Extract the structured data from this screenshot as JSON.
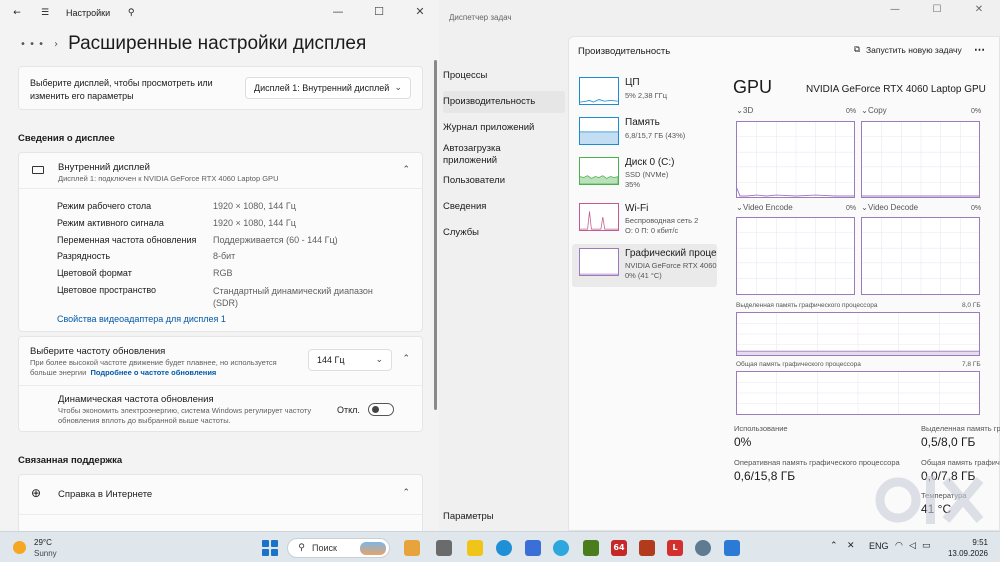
{
  "settings": {
    "title": "Настройки",
    "page_title": "Расширенные настройки дисплея",
    "select_display_text": "Выберите дисплей, чтобы просмотреть или изменить его параметры",
    "select_display_text_l1": "Выберите дисплей, чтобы просмотреть или",
    "select_display_text_l2": "изменить его параметры",
    "selected_display": "Дисплей 1: Внутренний дисплей",
    "display_info_heading": "Сведения о дисплее",
    "display_name": "Внутренний дисплей",
    "display_connection": "Дисплей 1: подключен к NVIDIA GeForce RTX 4060 Laptop GPU",
    "properties": [
      {
        "label": "Режим рабочего стола",
        "value": "1920 × 1080, 144 Гц"
      },
      {
        "label": "Режим активного сигнала",
        "value": "1920 × 1080, 144 Гц"
      },
      {
        "label": "Переменная частота обновления",
        "value": "Поддерживается (60 - 144 Гц)"
      },
      {
        "label": "Разрядность",
        "value": "8-бит"
      },
      {
        "label": "Цветовой формат",
        "value": "RGB"
      },
      {
        "label": "Цветовое пространство",
        "value": "Стандартный динамический диапазон (SDR)"
      }
    ],
    "color_space_value_l1": "Стандартный динамический диапазон",
    "color_space_value_l2": "(SDR)",
    "adapter_link": "Свойства видеоадаптера для дисплея 1",
    "refresh_title": "Выберите частоту обновления",
    "refresh_desc_l1": "При более высокой частоте движение будет плавнее, но используется",
    "refresh_desc_l2": "больше энергии",
    "refresh_link": "Подробнее о частоте обновления",
    "refresh_value": "144 Гц",
    "dynamic_title": "Динамическая частота обновления",
    "dynamic_desc_l1": "Чтобы экономить электроэнергию, система Windows регулирует частоту",
    "dynamic_desc_l2": "обновления вплоть до выбранной выше частоты.",
    "dynamic_state": "Откл.",
    "related_heading": "Связанная поддержка",
    "help_item": "Справка в Интернете"
  },
  "taskmanager": {
    "title": "Диспетчер задач",
    "nav": [
      "Процессы",
      "Производительность",
      "Журнал приложений",
      "Автозагрузка приложений",
      "Пользователи",
      "Сведения",
      "Службы"
    ],
    "nav_autostart_l1": "Автозагрузка",
    "nav_autostart_l2": "приложений",
    "nav_settings": "Параметры",
    "active_nav": "Производительность",
    "header": "Производительность",
    "run_task": "Запустить новую задачу",
    "resources": [
      {
        "name": "ЦП",
        "sub1": "5%  2,38 ГГц",
        "sub2": ""
      },
      {
        "name": "Память",
        "sub1": "6,8/15,7 ГБ (43%)",
        "sub2": ""
      },
      {
        "name": "Диск 0 (C:)",
        "sub1": "SSD (NVMe)",
        "sub2": "35%"
      },
      {
        "name": "Wi-Fi",
        "sub1": "Беспроводная сеть 2",
        "sub2": "О: 0 П: 0 кбит/с"
      },
      {
        "name": "Графический проце",
        "sub1": "NVIDIA GeForce RTX 4060",
        "sub2": "0%  (41 °C)"
      }
    ],
    "gpu": {
      "heading": "GPU",
      "model": "NVIDIA GeForce RTX 4060 Laptop GPU",
      "engines": [
        {
          "name": "3D",
          "pct": "0%"
        },
        {
          "name": "Copy",
          "pct": "0%"
        },
        {
          "name": "Video Encode",
          "pct": "0%"
        },
        {
          "name": "Video Decode",
          "pct": "0%"
        }
      ],
      "dedicated_label": "Выделенная память графического процессора",
      "dedicated_max": "8,0 ГБ",
      "shared_label": "Общая память графического процессора",
      "shared_max": "7,8 ГБ",
      "usage_label": "Использование",
      "usage_value": "0%",
      "dedicated_stat_label": "Выделенная память гр",
      "dedicated_stat_value": "0,5/8,0 ГБ",
      "gpu_mem_label": "Оперативная память графического процессора",
      "gpu_mem_value": "0,6/15,8 ГБ",
      "shared_stat_label": "Общая память графич",
      "shared_stat_value": "0,0/7,8 ГБ",
      "temp_label": "Температура",
      "temp_value": "41 °C"
    }
  },
  "taskbar": {
    "weather_temp": "29°C",
    "weather_cond": "Sunny",
    "search_placeholder": "Поиск",
    "lang": "ENG",
    "time": "9:51",
    "date": "13.09.2026"
  },
  "colors": {
    "accent": "#0059a9",
    "gpu_graph": "#9c7bbd",
    "cpu_graph": "#1e8bd1",
    "disk_graph": "#4caf50"
  }
}
